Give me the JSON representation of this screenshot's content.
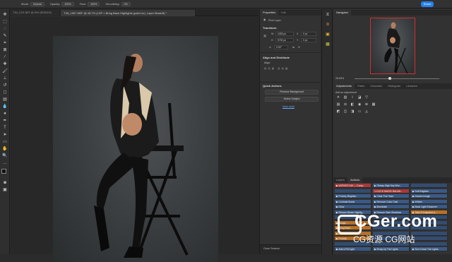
{
  "options_bar": {
    "mode_label": "Mode:",
    "mode_value": "Normal",
    "opacity_label": "Opacity:",
    "opacity_value": "100%",
    "flow_label": "Flow:",
    "flow_value": "100%",
    "smoothing_label": "Smoothing:",
    "smoothing_value": "0%",
    "share_label": "Share"
  },
  "document": {
    "tab_title": "TJN_1507.NEF @ 28.7% (LSP > Bring Back Highlights (paint on), Layer Mask/8) *",
    "tab_title_prev": "TJN_1221.NEF @ 25% (RGB/16*)"
  },
  "properties": {
    "tabs": [
      "Properties",
      "Info"
    ],
    "layer_type": "Pixel Layer",
    "transform_title": "Transform",
    "w_label": "W",
    "w_value": "4453 px",
    "h_label": "H",
    "h_value": "5792 px",
    "x_value": "0 px",
    "y_value": "0 px",
    "angle_value": "0.00°",
    "align_title": "Align and Distribute",
    "align_label": "Align:",
    "quick_actions_title": "Quick Actions",
    "remove_bg_label": "Remove Background",
    "select_subject_label": "Select Subject",
    "view_more_label": "View more",
    "close_session_label": "Close Session"
  },
  "navigator": {
    "title": "Navigator",
    "zoom_value": "28.69%"
  },
  "adjustments": {
    "tabs": [
      "Adjustments",
      "Paths",
      "Channels",
      "Histogram",
      "Libraries"
    ],
    "add_label": "Add an adjustment",
    "icons": [
      "sun-icon",
      "levels-icon",
      "curves-icon",
      "exposure-icon",
      "triangle-icon",
      "vibrance-icon",
      "hue-icon",
      "balance-icon",
      "bw-icon",
      "camera-icon",
      "lookup-icon",
      "grid-icon",
      "invert-icon",
      "posterize-icon",
      "threshold-icon",
      "gradient-map-icon",
      "selective-color-icon"
    ]
  },
  "actions": {
    "tabs": [
      "Layers",
      "Actions"
    ],
    "rows": [
      [
        {
          "label": "▶ WORKFLOW — Comp...",
          "color": "red"
        },
        {
          "label": "▶ Glossy High Key Wor...",
          "color": "blue"
        },
        {
          "label": "",
          "color": "navy"
        }
      ],
      [
        {
          "label": "",
          "color": "navy"
        },
        {
          "label": "1-CLICK MAGIC BALAN...",
          "color": "red"
        },
        {
          "label": "▶ Soft Brighten",
          "color": "blue"
        }
      ],
      [
        {
          "label": "▶ Punchy Brighten",
          "color": "blue"
        },
        {
          "label": "▶ Clear The Haze",
          "color": "blue"
        },
        {
          "label": "▶ Darken Image",
          "color": "blue"
        }
      ],
      [
        {
          "label": "▶ Contrast Boost",
          "color": "blue"
        },
        {
          "label": "▶ Remove Color Cast",
          "color": "blue"
        },
        {
          "label": "▶ Whiten",
          "color": "blue"
        }
      ],
      [
        {
          "label": "▶ Glow",
          "color": "blue"
        },
        {
          "label": "▶ Illuminate",
          "color": "blue"
        },
        {
          "label": "▶ Back Light Enhancer",
          "color": "blue"
        }
      ],
      [
        {
          "label": "▶ Rescue Blown Highlig...",
          "color": "blue"
        },
        {
          "label": "▶ Rescue Dark Shadows",
          "color": "blue"
        },
        {
          "label": "▶ Take A Snapshot a...",
          "color": "orange"
        }
      ],
      [
        {
          "label": "",
          "color": "navy"
        },
        {
          "label": "",
          "color": "navy"
        },
        {
          "label": "",
          "color": "navy"
        }
      ],
      [
        {
          "label": "▶ Dodge ...",
          "color": "orange"
        },
        {
          "label": "",
          "color": "navy"
        },
        {
          "label": "",
          "color": "navy"
        }
      ],
      [
        {
          "label": "▶ Bring Back...",
          "color": "orange"
        },
        {
          "label": "",
          "color": "navy"
        },
        {
          "label": "",
          "color": "navy"
        }
      ],
      [
        {
          "label": "▶ Paint Aw...",
          "color": "orange"
        },
        {
          "label": "",
          "color": "navy"
        },
        {
          "label": "",
          "color": "navy"
        }
      ],
      [
        {
          "label": "▶ Portrait ...",
          "color": "orange"
        },
        {
          "label": "",
          "color": "navy"
        },
        {
          "label": "",
          "color": "navy"
        }
      ],
      [
        {
          "label": "",
          "color": "navy"
        },
        {
          "label": "",
          "color": "navy"
        },
        {
          "label": "",
          "color": "navy"
        }
      ],
      [
        {
          "label": "▶ Add a Fill Light",
          "color": "blue"
        },
        {
          "label": "▶ Bring Up The Lights",
          "color": "blue"
        },
        {
          "label": "▶ Turn Down The Lights",
          "color": "blue"
        }
      ]
    ]
  },
  "watermark": {
    "main": "CGer.com",
    "sub": "CG资源 CG网站"
  },
  "colors": {
    "accent": "#2680eb",
    "action_blue": "#3a5a86",
    "action_red": "#a8383a",
    "action_orange": "#b5702a"
  }
}
